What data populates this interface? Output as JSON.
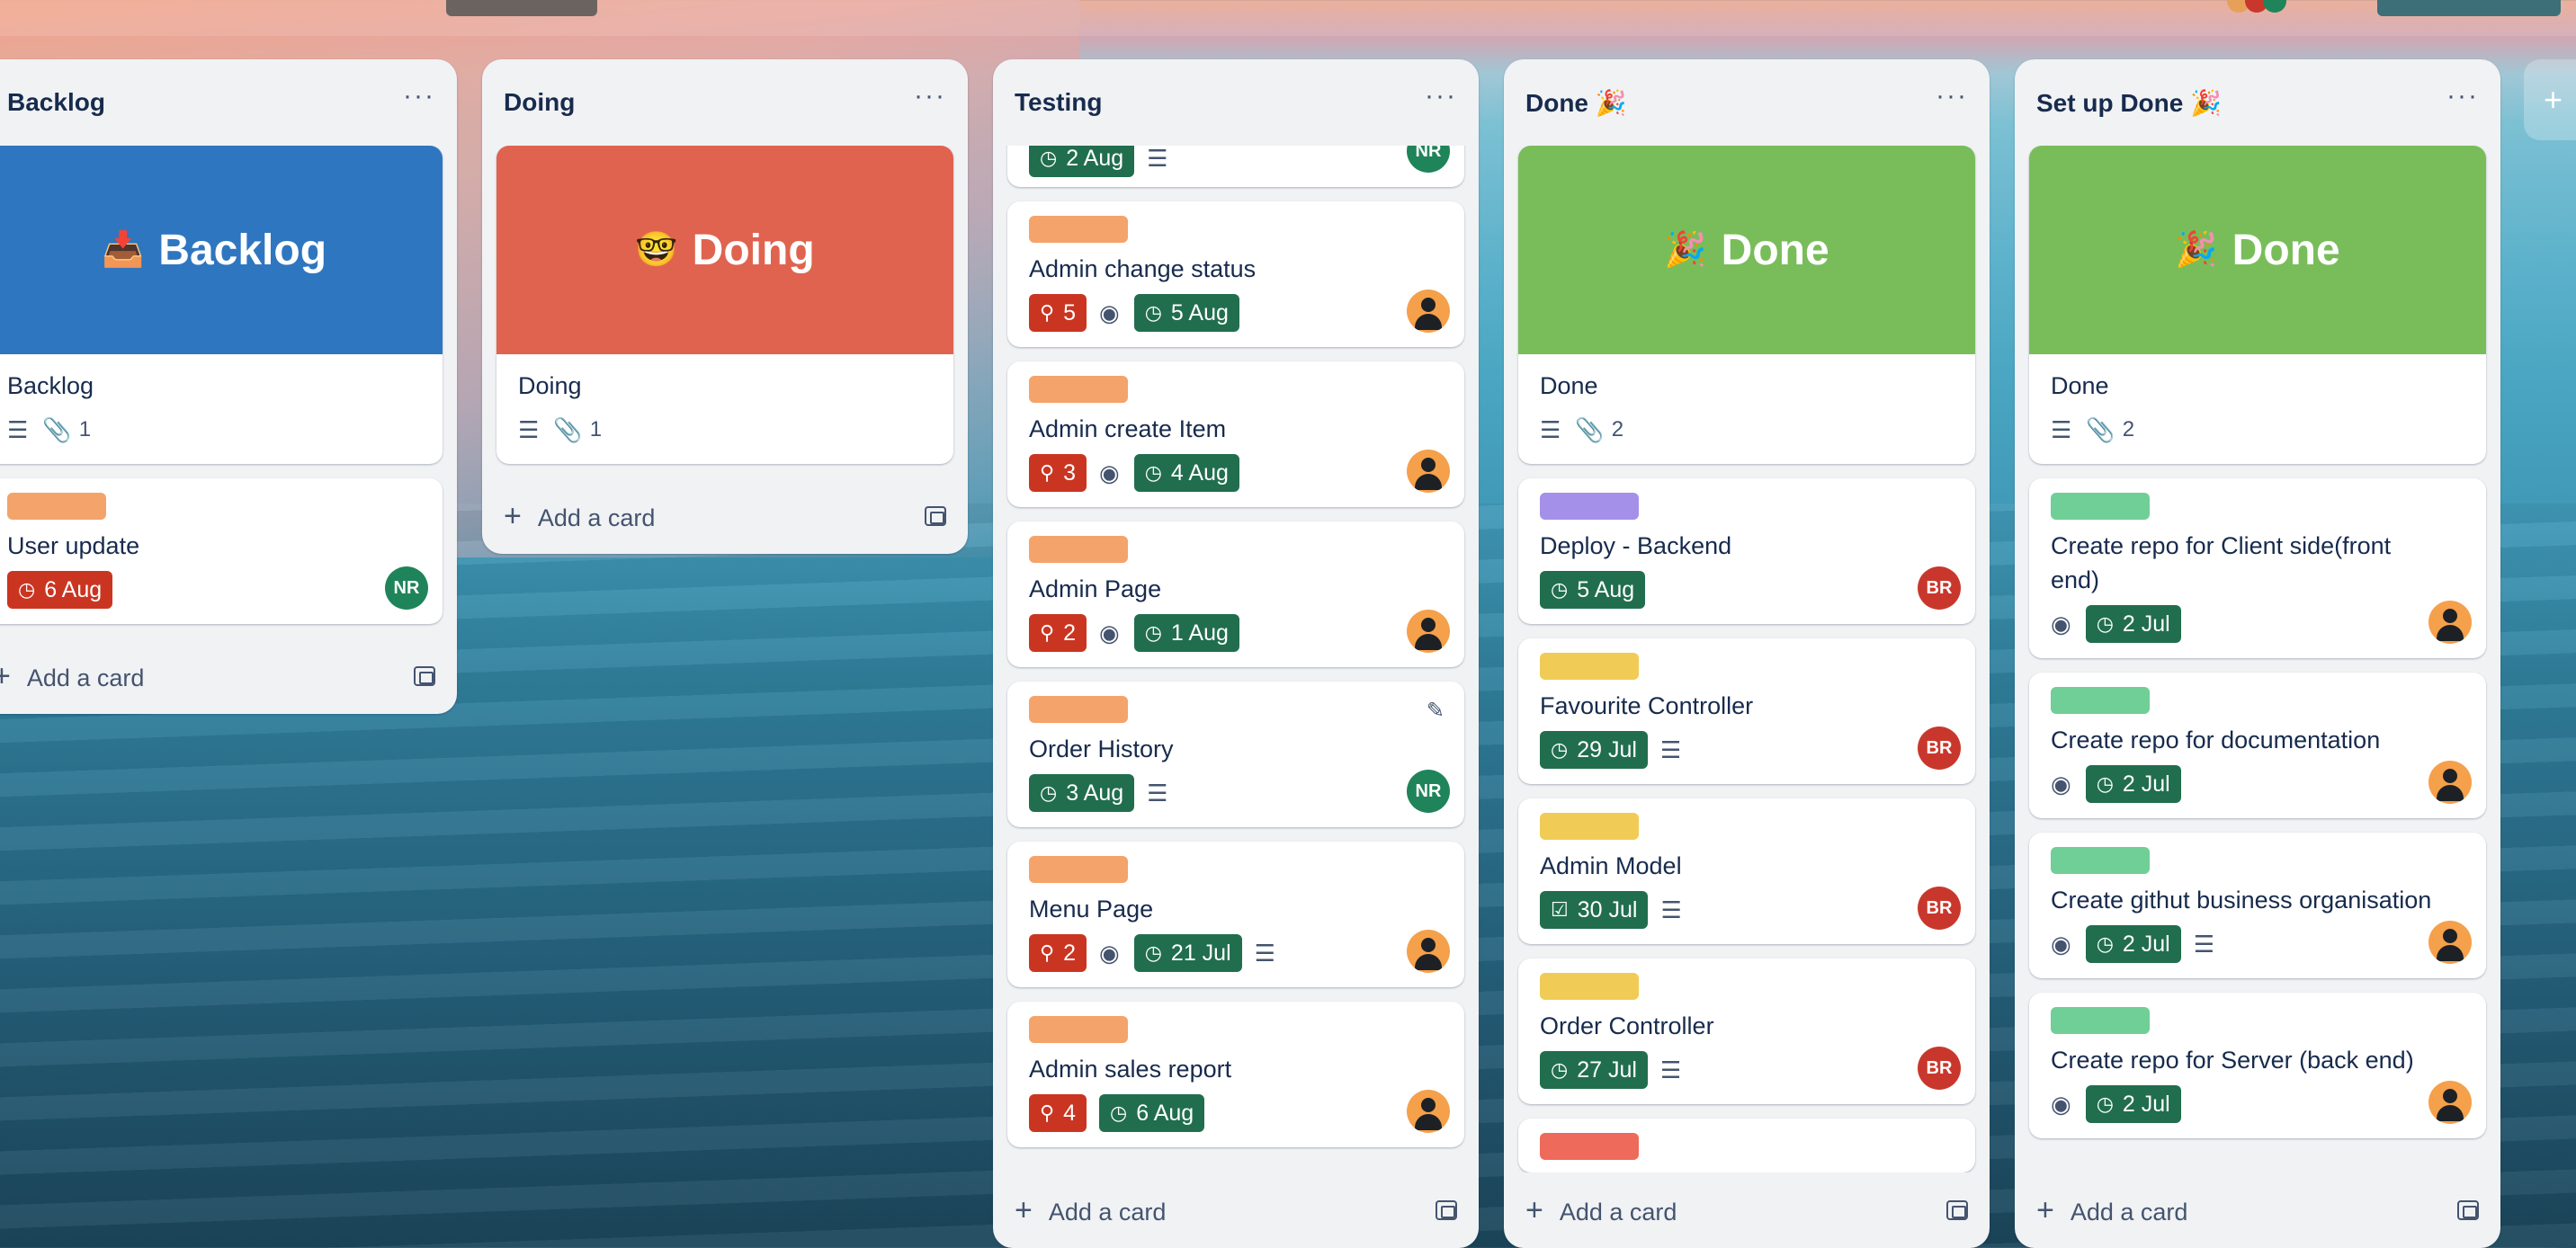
{
  "colors": {
    "backlog_cover": "#2f76c0",
    "doing_cover": "#e0634f",
    "done_cover": "#78bd5a",
    "label_orange": "#f4a36a",
    "label_purple": "#a490e8",
    "label_yellow": "#f0cc57",
    "label_green": "#6fcf97",
    "label_red": "#ee6a5b",
    "badge_red": "#ca3521",
    "badge_green": "#216e4e"
  },
  "lists": [
    {
      "title": "Backlog",
      "menu": "···",
      "cover": {
        "emoji": "📥",
        "text": "Backlog"
      },
      "cards": [
        {
          "title": "Backlog",
          "attachments": "1"
        },
        {
          "title": "User update",
          "due": "6 Aug",
          "avatar": "NR"
        }
      ],
      "add_card": "Add a card"
    },
    {
      "title": "Doing",
      "menu": "···",
      "cover": {
        "emoji": "🤓",
        "text": "Doing"
      },
      "cards": [
        {
          "title": "Doing",
          "attachments": "1"
        }
      ],
      "add_card": "Add a card"
    },
    {
      "title": "Testing",
      "menu": "···",
      "cards": [
        {
          "due": "2 Aug",
          "avatar": "NR"
        },
        {
          "title": "Admin change status",
          "votes": "5",
          "due": "5 Aug"
        },
        {
          "title": "Admin create Item",
          "votes": "3",
          "due": "4 Aug"
        },
        {
          "title": "Admin Page",
          "votes": "2",
          "due": "1 Aug"
        },
        {
          "title": "Order History",
          "due": "3 Aug",
          "avatar": "NR"
        },
        {
          "title": "Menu Page",
          "votes": "2",
          "due": "21 Jul"
        },
        {
          "title": "Admin sales report",
          "votes": "4",
          "due": "6 Aug"
        }
      ],
      "add_card": "Add a card"
    },
    {
      "title": "Done 🎉",
      "menu": "···",
      "cover": {
        "emoji": "🎉",
        "text": "Done"
      },
      "cards": [
        {
          "title": "Done",
          "attachments": "2"
        },
        {
          "title": "Deploy - Backend",
          "due": "5 Aug",
          "avatar": "BR"
        },
        {
          "title": "Favourite Controller",
          "due": "29 Jul",
          "avatar": "BR"
        },
        {
          "title": "Admin Model",
          "due": "30 Jul",
          "avatar": "BR"
        },
        {
          "title": "Order Controller",
          "due": "27 Jul",
          "avatar": "BR"
        }
      ],
      "add_card": "Add a card"
    },
    {
      "title": "Set up Done 🎉",
      "menu": "···",
      "cover": {
        "emoji": "🎉",
        "text": "Done"
      },
      "cards": [
        {
          "title": "Done",
          "attachments": "2"
        },
        {
          "title": "Create repo for Client side(front end)",
          "due": "2 Jul"
        },
        {
          "title": "Create repo for documentation",
          "due": "2 Jul"
        },
        {
          "title": "Create githut business organisation",
          "due": "2 Jul"
        },
        {
          "title": "Create repo for Server (back end)",
          "due": "2 Jul"
        }
      ],
      "add_card": "Add a card"
    }
  ],
  "add_list": "+"
}
